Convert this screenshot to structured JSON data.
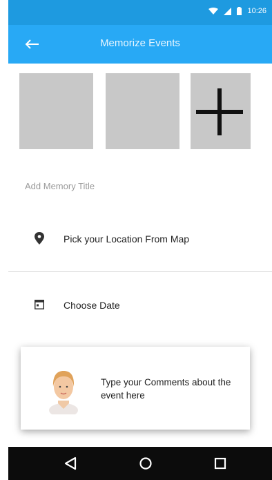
{
  "status_bar": {
    "time": "10:26"
  },
  "app_bar": {
    "title": "Memorize Events"
  },
  "photos": {
    "add_label": "+"
  },
  "form": {
    "title_placeholder": "Add Memory Title",
    "location_label": "Pick your Location From Map",
    "date_label": "Choose Date"
  },
  "comment_card": {
    "placeholder": "Type your Comments about the event here"
  },
  "icons": {
    "back": "arrow-left-icon",
    "location": "map-pin-icon",
    "date": "calendar-icon",
    "add": "plus-icon"
  },
  "colors": {
    "status_bar": "#1e9ae0",
    "app_bar": "#28a9f5",
    "photo_placeholder": "#c8c8c8",
    "nav_bar": "#0c0c0c"
  }
}
